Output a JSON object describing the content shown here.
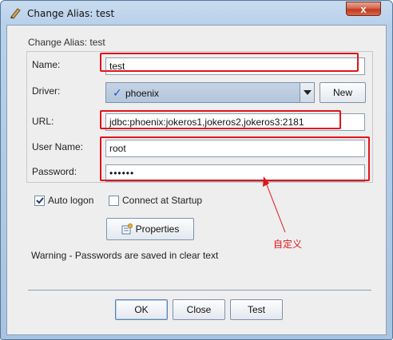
{
  "window": {
    "title": "Change Alias: test",
    "close_glyph": "x"
  },
  "dialog": {
    "heading": "Change Alias: test",
    "fields": {
      "name_label": "Name:",
      "name_value": "test",
      "driver_label": "Driver:",
      "driver_value": "phoenix",
      "driver_icon": "checkmark-icon",
      "new_button": "New",
      "url_label": "URL:",
      "url_value": "jdbc:phoenix:jokeros1,jokeros2,jokeros3:2181",
      "username_label": "User Name:",
      "username_value": "root",
      "password_label": "Password:",
      "password_value": "••••••"
    },
    "options": {
      "auto_logon_label": "Auto logon",
      "auto_logon_checked": true,
      "connect_startup_label": "Connect at Startup",
      "connect_startup_checked": false
    },
    "properties_button": "Properties",
    "warning": "Warning - Passwords are saved in clear text",
    "buttons": {
      "ok": "OK",
      "close": "Close",
      "test": "Test"
    }
  },
  "annotation": {
    "text": "自定义",
    "color": "#e0141b"
  }
}
